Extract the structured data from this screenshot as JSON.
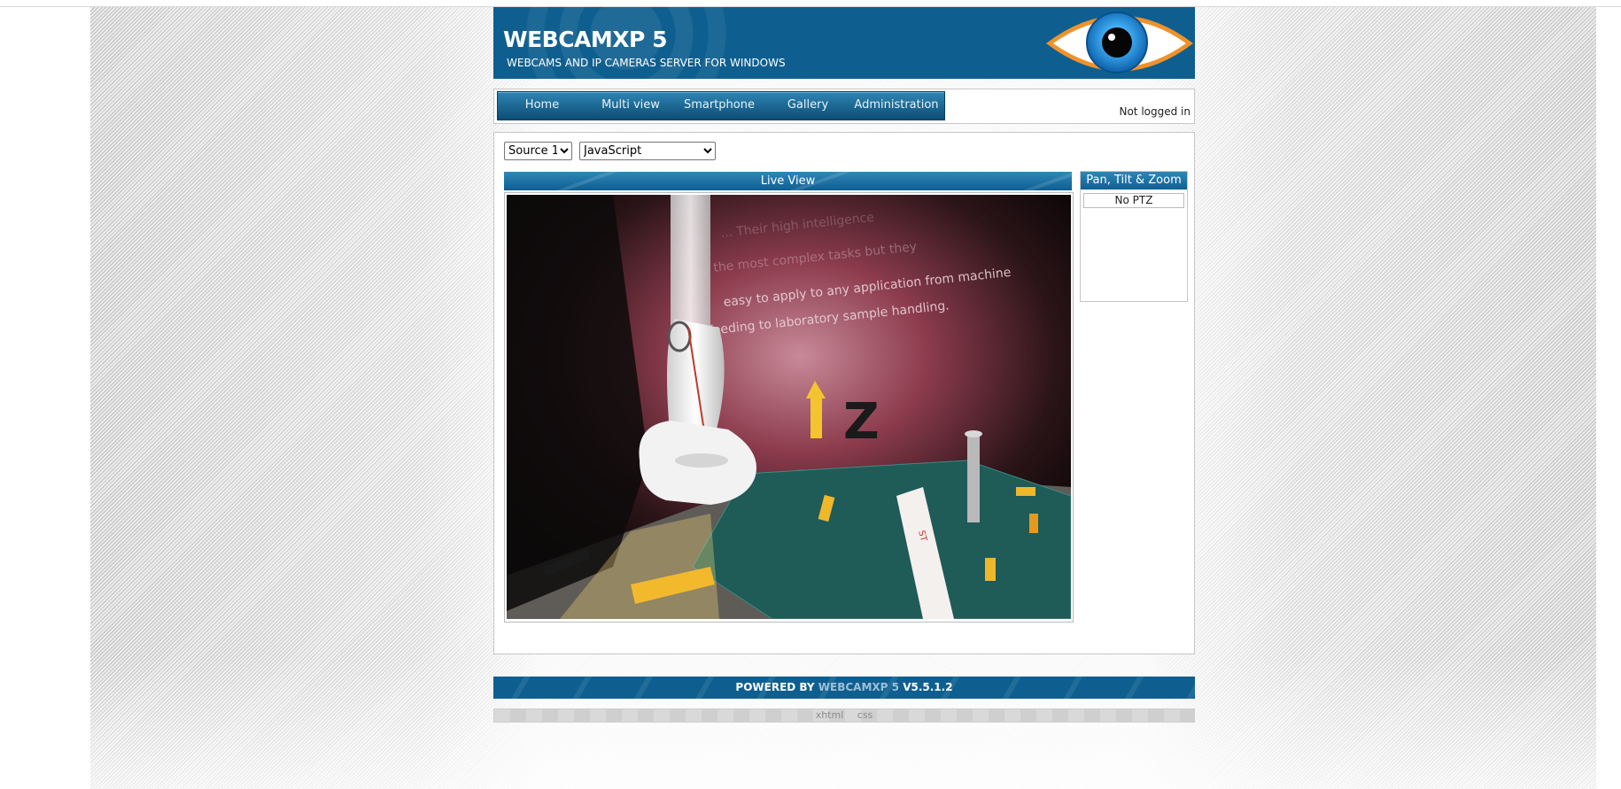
{
  "header": {
    "title": "WEBCAMXP 5",
    "subtitle": "WEBCAMS AND IP CAMERAS SERVER FOR WINDOWS"
  },
  "nav": {
    "items": [
      {
        "label": "Home"
      },
      {
        "label": "Multi view"
      },
      {
        "label": "Smartphone"
      },
      {
        "label": "Gallery"
      },
      {
        "label": "Administration"
      }
    ],
    "login_status": "Not logged in"
  },
  "controls": {
    "source_selected": "Source 1",
    "mode_selected": "JavaScript"
  },
  "live_view": {
    "title": "Live View",
    "scene_text": [
      "... Their high intelligence",
      "... the most complex tasks but they",
      "easy to apply to any application from machine",
      "feeding to laboratory sample handling."
    ],
    "scene_letter": "Z"
  },
  "ptz": {
    "title": "Pan, Tilt & Zoom",
    "status": "No PTZ"
  },
  "footer": {
    "prefix": "POWERED BY",
    "brand": "WEBCAMXP 5",
    "version": "V5.5.1.2",
    "links": [
      "xhtml",
      "css"
    ]
  },
  "colors": {
    "header_blue": "#0e5f8f",
    "eye_iris": "#2f9ee6",
    "eye_ring": "#f0922b"
  }
}
